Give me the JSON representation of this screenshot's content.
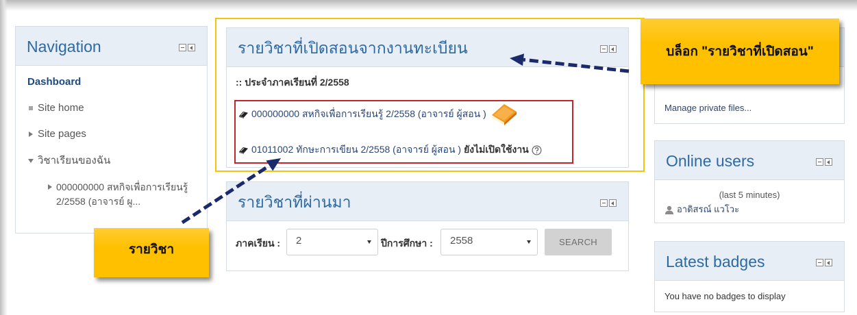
{
  "navigation": {
    "title": "Navigation",
    "block_controls": [
      "dock-minimize-icon",
      "dock-move-icon"
    ],
    "items": [
      {
        "label": "Dashboard"
      },
      {
        "label": "Site home",
        "icon": "square-bullet-icon"
      },
      {
        "label": "Site pages",
        "icon": "triangle-right-icon"
      },
      {
        "label": "วิชาเรียนของฉัน",
        "icon": "triangle-down-icon"
      },
      {
        "label": "000000000 สหกิจเพื่อการเรียนรู้ 2/2558 (อาจารย์ ผู...",
        "icon": "triangle-right-icon"
      }
    ]
  },
  "current_courses": {
    "title": "รายวิชาที่เปิดสอนจากงานทะเบียน",
    "term_label": ":: ประจำภาคเรียนที่ 2/2558",
    "courses": [
      {
        "label": "000000000 สหกิจเพื่อการเรียนรู้ 2/2558 (อาจารย์ ผู้สอน )",
        "icon": "course-book-icon",
        "extra_icon": "orange-book-icon"
      },
      {
        "label": "01011002 ทักษะการเขียน 2/2558 (อาจารย์ ผู้สอน )",
        "status": "ยังไม่เปิดใช้งาน",
        "icon": "course-book-icon",
        "extra_icon": "help-icon"
      }
    ]
  },
  "past_courses": {
    "title": "รายวิชาที่ผ่านมา",
    "semester_label": "ภาคเรียน :",
    "semester_value": "2",
    "year_label": "ปีการศึกษา :",
    "year_value": "2558",
    "search_label": "SEARCH"
  },
  "private_files": {
    "manage_link": "Manage private files..."
  },
  "online_users": {
    "title": "Online users",
    "period": "(last 5 minutes)",
    "users": [
      {
        "name": "อาดิสรณ์ แวโวะ",
        "icon": "user-icon"
      }
    ]
  },
  "latest_badges": {
    "title": "Latest badges",
    "empty_message": "You have no badges to display"
  },
  "annotations": {
    "block_callout": "บล็อก \"รายวิชาที่เปิดสอน\"",
    "course_callout": "รายวิชา"
  },
  "colors": {
    "block-title": "#2d6aa3",
    "header-bg": "#e8eef6",
    "block-border": "#d6dce4",
    "link": "#2a4673",
    "nav-dashboard": "#1c4b7e",
    "course-outline": "#c0262c",
    "highlight-outline": "#f2c40c",
    "callout-bg": "#ffc000",
    "arrow": "#1b2a6b"
  }
}
